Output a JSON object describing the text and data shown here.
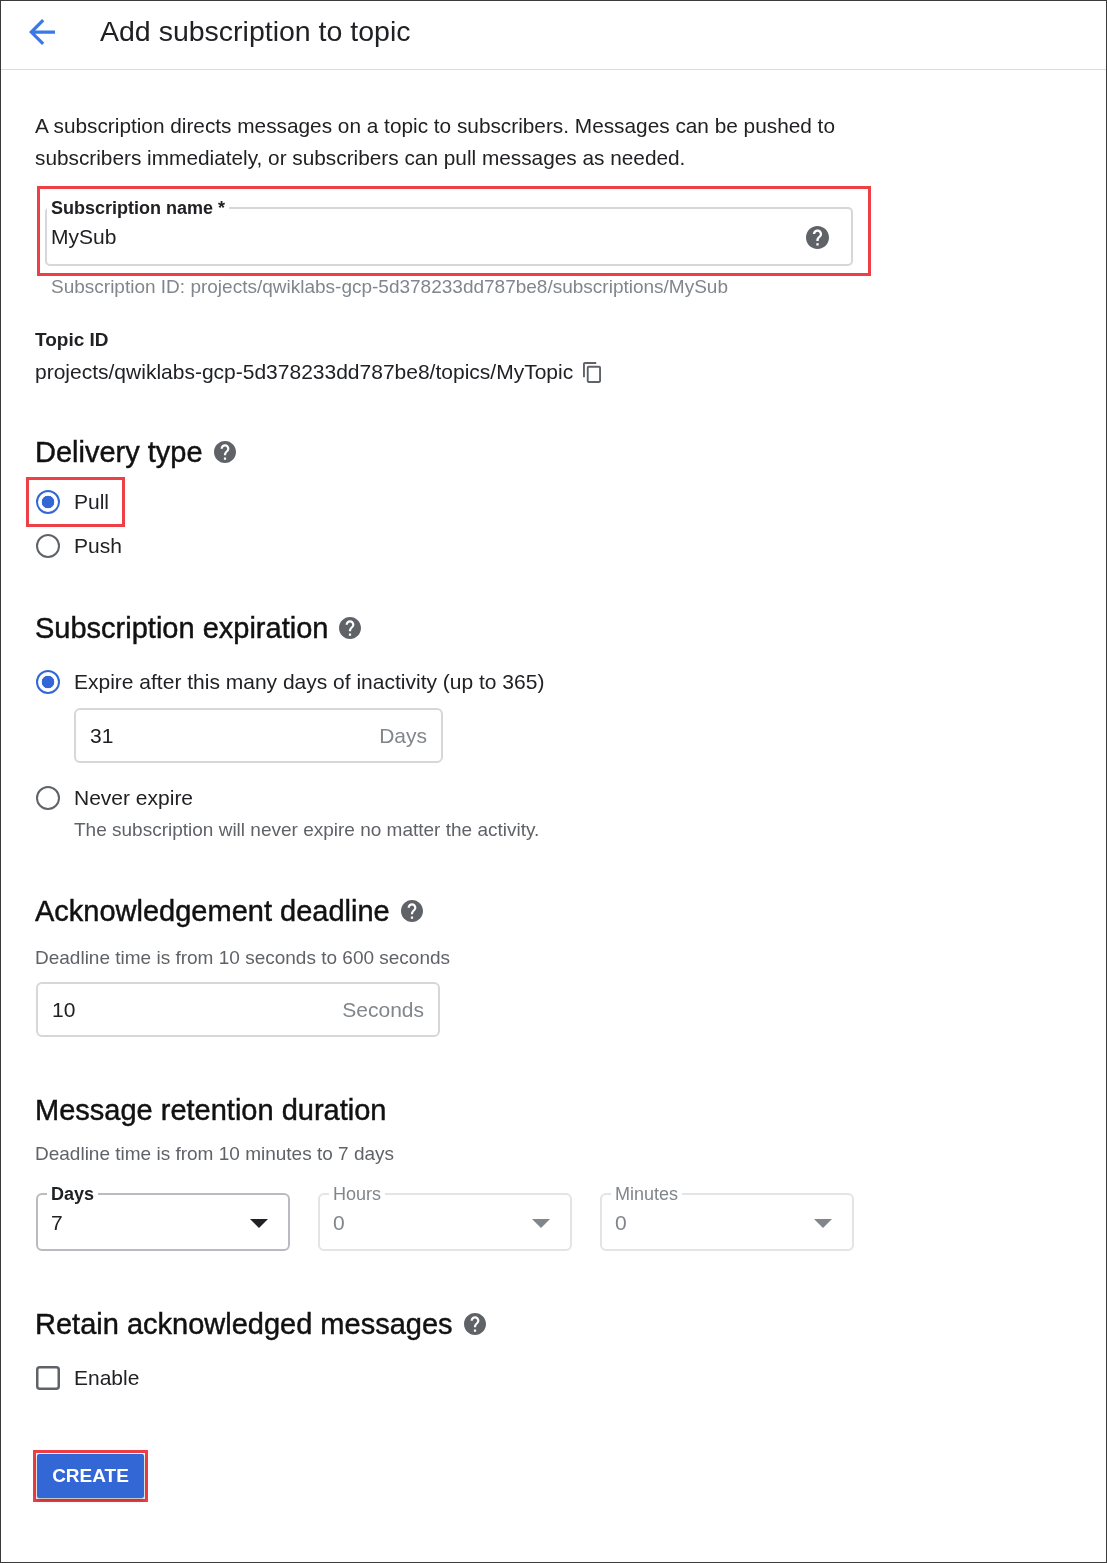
{
  "header": {
    "title": "Add subscription to topic"
  },
  "description": "A subscription directs messages on a topic to subscribers. Messages can be pushed to subscribers immediately, or subscribers can pull messages as needed.",
  "subscription_name": {
    "label": "Subscription name *",
    "value": "MySub",
    "helper": "Subscription ID: projects/qwiklabs-gcp-5d378233dd787be8/subscriptions/MySub",
    "highlighted": true
  },
  "topic": {
    "label": "Topic ID",
    "value": "projects/qwiklabs-gcp-5d378233dd787be8/topics/MyTopic"
  },
  "delivery_type": {
    "title": "Delivery type",
    "help": true,
    "options": [
      {
        "label": "Pull",
        "selected": true,
        "highlighted": true
      },
      {
        "label": "Push",
        "selected": false,
        "highlighted": false
      }
    ]
  },
  "subscription_expiration": {
    "title": "Subscription expiration",
    "help": true,
    "options": [
      {
        "label": "Expire after this many days of inactivity (up to 365)",
        "selected": true,
        "highlighted": false,
        "input": {
          "value": "31",
          "suffix": "Days"
        }
      },
      {
        "label": "Never expire",
        "selected": false,
        "highlighted": false,
        "helper": "The subscription will never expire no matter the activity."
      }
    ]
  },
  "acknowledgement_deadline": {
    "title": "Acknowledgement deadline",
    "help": true,
    "helper": "Deadline time is from 10 seconds to 600 seconds",
    "input": {
      "value": "10",
      "suffix": "Seconds"
    }
  },
  "message_retention_duration": {
    "title": "Message retention duration",
    "help": false,
    "helper": "Deadline time is from 10 minutes to 7 days",
    "selects": [
      {
        "label": "Days",
        "value": "7",
        "disabled": false
      },
      {
        "label": "Hours",
        "value": "0",
        "disabled": true
      },
      {
        "label": "Minutes",
        "value": "0",
        "disabled": true
      }
    ]
  },
  "retain_acknowledged_messages": {
    "title": "Retain acknowledged messages",
    "help": true,
    "checkbox": {
      "label": "Enable",
      "checked": false
    }
  },
  "create_button": {
    "label": "CREATE",
    "highlighted": true
  }
}
